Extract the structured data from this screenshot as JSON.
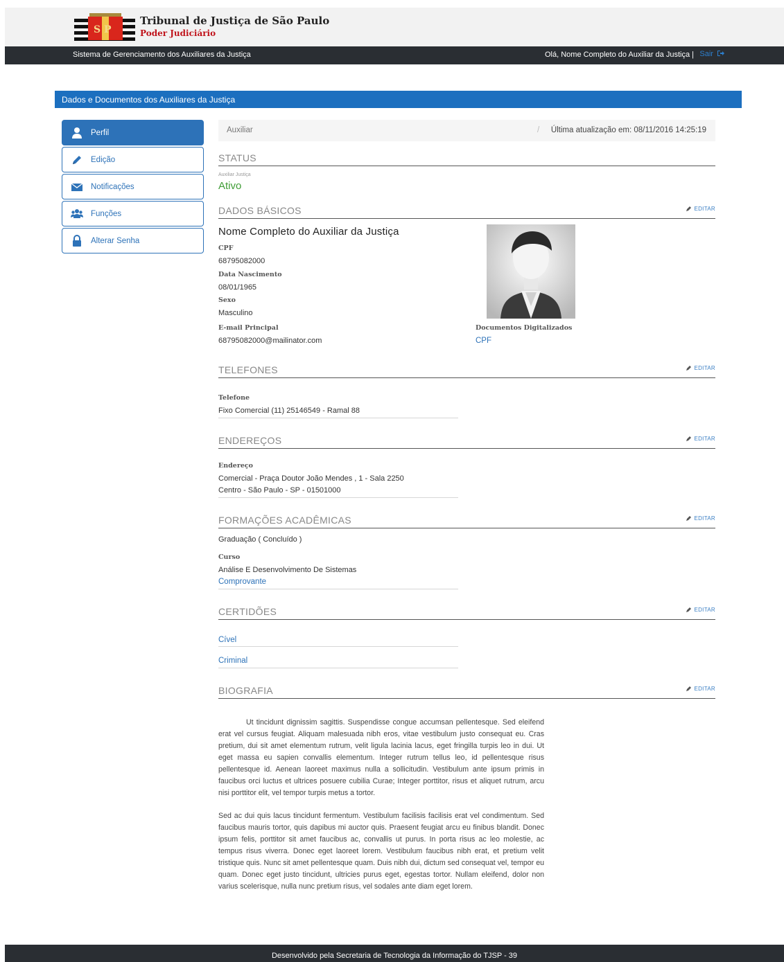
{
  "header": {
    "logo_text": "S P",
    "title": "Tribunal de Justiça de São Paulo",
    "subtitle": "Poder Judiciário"
  },
  "nav": {
    "system_name": "Sistema de Gerenciamento dos Auxiliares da Justiça",
    "user_greeting": "Olá, Nome Completo do Auxiliar da Justiça |",
    "logout_label": "Sair"
  },
  "section_title": "Dados e Documentos dos Auxiliares da Justiça",
  "sidebar": {
    "items": [
      {
        "label": "Perfil",
        "icon": "user-icon",
        "active": true
      },
      {
        "label": "Edição",
        "icon": "pencil-icon",
        "active": false
      },
      {
        "label": "Notificações",
        "icon": "envelope-icon",
        "active": false
      },
      {
        "label": "Funções",
        "icon": "users-icon",
        "active": false
      },
      {
        "label": "Alterar Senha",
        "icon": "lock-icon",
        "active": false
      }
    ]
  },
  "breadcrumb": {
    "left": "Auxiliar",
    "separator": "/",
    "right": "Última atualização em: 08/11/2016 14:25:19"
  },
  "edit_label": "EDITAR",
  "status": {
    "title": "STATUS",
    "label": "Auxiliar Justiça",
    "value": "Ativo"
  },
  "basic": {
    "title": "DADOS BÁSICOS",
    "full_name": "Nome Completo do Auxiliar da Justiça",
    "cpf_label": "CPF",
    "cpf": "68795082000",
    "birth_label": "Data Nascimento",
    "birth": "08/01/1965",
    "sex_label": "Sexo",
    "sex": "Masculino",
    "email_label": "E-mail Principal",
    "email": "68795082000@mailinator.com",
    "docs_label": "Documentos Digitalizados",
    "docs_link": "CPF"
  },
  "phones": {
    "title": "TELEFONES",
    "label": "Telefone",
    "value": "Fixo Comercial (11) 25146549 - Ramal 88"
  },
  "addresses": {
    "title": "ENDEREÇOS",
    "label": "Endereço",
    "line1": "Comercial - Praça Doutor João Mendes , 1 - Sala 2250",
    "line2": "Centro - São Paulo - SP - 01501000"
  },
  "education": {
    "title": "FORMAÇÕES ACADÊMICAS",
    "level": "Graduação ( Concluído )",
    "course_label": "Curso",
    "course": "Análise E Desenvolvimento De Sistemas",
    "proof_link": "Comprovante"
  },
  "certificates": {
    "title": "CERTIDÕES",
    "items": [
      "Cível",
      "Criminal"
    ]
  },
  "biography": {
    "title": "BIOGRAFIA",
    "p1": "Ut tincidunt dignissim sagittis. Suspendisse congue accumsan pellentesque. Sed eleifend erat vel cursus feugiat. Aliquam malesuada nibh eros, vitae vestibulum justo consequat eu. Cras pretium, dui sit amet elementum rutrum, velit ligula lacinia lacus, eget fringilla turpis leo in dui. Ut eget massa eu sapien convallis elementum. Integer rutrum tellus leo, id pellentesque risus pellentesque id. Aenean laoreet maximus nulla a sollicitudin. Vestibulum ante ipsum primis in faucibus orci luctus et ultrices posuere cubilia Curae; Integer porttitor, risus et aliquet rutrum, arcu nisi porttitor elit, vel tempor turpis metus a tortor.",
    "p2": "Sed ac dui quis lacus tincidunt fermentum. Vestibulum facilisis facilisis erat vel condimentum. Sed faucibus mauris tortor, quis dapibus mi auctor quis. Praesent feugiat arcu eu finibus blandit. Donec ipsum felis, porttitor sit amet faucibus ac, convallis ut purus. In porta risus ac leo molestie, ac tempus risus viverra. Donec eget laoreet lorem. Vestibulum faucibus nibh erat, et pretium velit tristique quis. Nunc sit amet pellentesque quam. Duis nibh dui, dictum sed consequat vel, tempor eu quam. Donec eget justo tincidunt, ultricies purus eget, egestas tortor. Nullam eleifend, dolor non varius scelerisque, nulla nunc pretium risus, vel sodales ante diam eget lorem."
  },
  "footer": {
    "text": "Desenvolvido pela Secretaria de Tecnologia da Informação do TJSP - 39"
  },
  "colors": {
    "primary": "#1c6fbf",
    "nav_dark": "#2a2e33",
    "status_green": "#3f9c35",
    "brand_red": "#c0131b"
  }
}
